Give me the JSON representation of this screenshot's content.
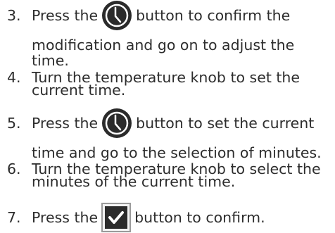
{
  "steps": [
    {
      "number": "3.",
      "before_icon": "Press the",
      "icon": "clock-icon",
      "after_icon": "button to confirm the",
      "continuation": [
        "modification and go on to adjust the",
        "time."
      ]
    },
    {
      "number": "4.",
      "lines": [
        "Turn the temperature knob to set the",
        "current time."
      ]
    },
    {
      "number": "5.",
      "before_icon": "Press the",
      "icon": "clock-icon",
      "after_icon": "button to set the current",
      "continuation": [
        "time and go to the selection of minutes."
      ]
    },
    {
      "number": "6.",
      "lines": [
        "Turn the temperature knob to select the",
        "minutes of the current time."
      ]
    },
    {
      "number": "7.",
      "before_icon": "Press the",
      "icon": "check-icon",
      "after_icon": "button to confirm."
    }
  ],
  "colors": {
    "text": "#2d2d2d",
    "icon_fill": "#2b2b2b",
    "icon_fg": "#ffffff",
    "check_border": "#9a9a9a"
  }
}
